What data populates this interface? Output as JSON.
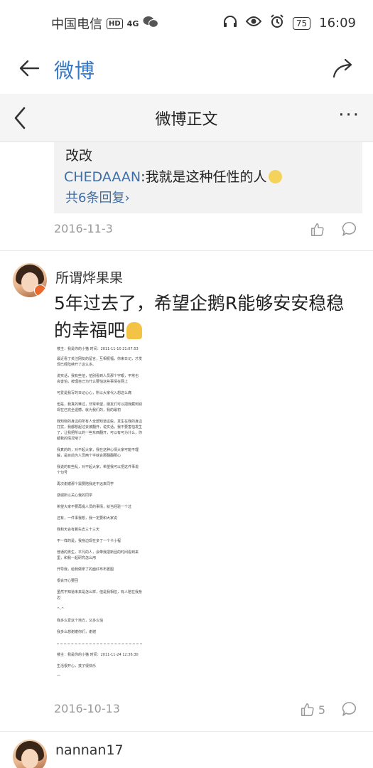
{
  "status_bar": {
    "carrier": "中国电信",
    "hd_badge": "HD",
    "signal_label": "4G",
    "battery": "75",
    "time": "16:09"
  },
  "browser_bar": {
    "title": "微博"
  },
  "nav_bar": {
    "title": "微博正文",
    "more": "···"
  },
  "reply_box": {
    "line1": "改改",
    "reply_user": "CHEDAAAN",
    "reply_text": ":我就是这种任性的人",
    "more_replies": "共6条回复",
    "more_chevron": "›"
  },
  "comment1": {
    "date": "2016-11-3"
  },
  "comment2": {
    "username": "所谓烨果果",
    "text": "5年过去了，希望企鹅R能够安安稳稳的幸福吧",
    "date": "2016-10-13",
    "like_count": "5"
  },
  "comment3": {
    "username": "nannan17"
  },
  "doc_image": {
    "lines": [
      "楼主：我是你的小猫  时间：2011-11-10 21:07:53",
      "最近看了关注网友的留言，互相祝福，你来日记，才发",
      "现已经陆续开了这么多。",
      "说实话，我有些怕，怕别看到人员那个字眼，平常也",
      "会害怕，按理自己为什么要怕这些事情在网上",
      "可爱是我写的日记心心，所以大家代入想这么痛",
      "但是，我真的难过，非常希望，朋友们可以把我藏到别",
      "现在已完全遗憾，就为我们的，我的最初",
      "我知晓的身边的所有人全部知道这些，发生在我的身边",
      "打扰，我都想起过去被翻开，说实话，我不要害怕发生",
      "了，让我把所以的一些东西翻开，可以有可为什么，你",
      "都我的情况吧了",
      "我真的的，对不起大家，我在这种心情大家可能不理",
      "解，是目前为人员两个字就会那翻翻那心",
      "我说的有些乱，对不起大家，希望我可以把这件事说",
      "个句号",
      "再次谢谢那个需要陪我走不远来同学",
      "感谢所以关心我的同学",
      "希望大家不要再提人员的事情，就当经验一个过",
      "还有，一件事我想，我一定要和大家说",
      "我和天会有着失去三十三天",
      "不一样的是，我身边现在多了一个卡小程",
      "普通的男生，平凡的人，会带我把新回的时间看到来",
      "里，和我一起研究怎么用",
      "开导我，给我做拿了的面红布布置图",
      "很会开心要回",
      "虽然不知道未来是怎么样，但是我相信，有人陪在我身",
      "边",
      "^-^",
      "我多么爱这个地方，又多么怕",
      "我多么想谢谢你们，谢谢",
      "",
      "楼主：我是你的小猫  时间：2011-11-24 12:36:30",
      "生活很开心，孩子很快乐",
      "一"
    ]
  },
  "colors": {
    "link_blue": "#3f6fa5",
    "title_blue": "#3478c6",
    "gray_text": "#999999",
    "reply_bg": "#f2f2f2"
  },
  "icons": [
    "back-arrow-icon",
    "share-icon",
    "chevron-left-icon",
    "more-icon",
    "like-icon",
    "comment-icon",
    "headphones-icon",
    "eye-icon",
    "alarm-icon",
    "wechat-icon"
  ]
}
